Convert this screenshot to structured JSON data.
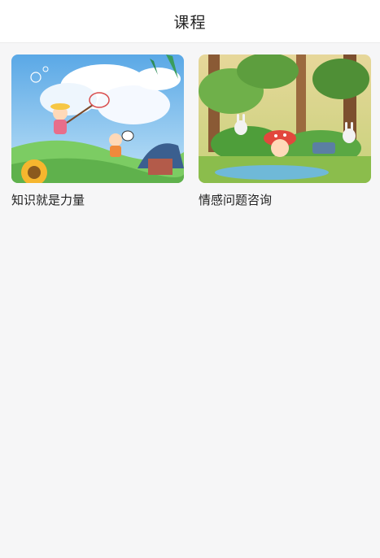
{
  "header": {
    "title": "课程"
  },
  "courses": [
    {
      "title": "知识就是力量"
    },
    {
      "title": "情感问题咨询"
    }
  ]
}
